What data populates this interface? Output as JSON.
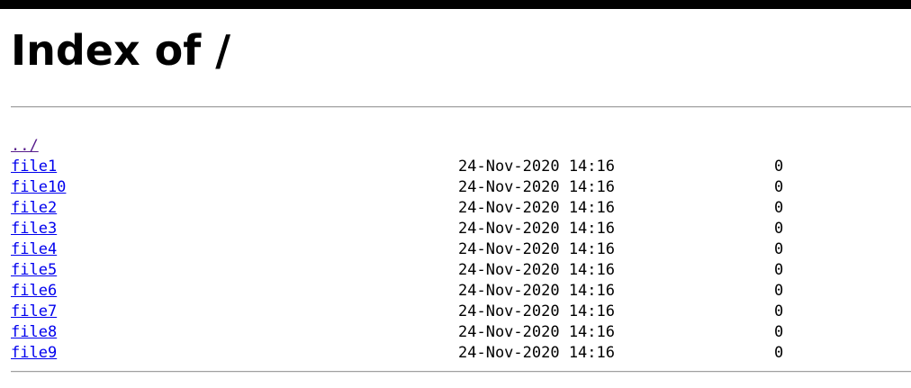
{
  "page_title": "Index of /",
  "listing": {
    "parent_link": "../",
    "entries": [
      {
        "name": "file1",
        "date": "24-Nov-2020 14:16",
        "size": "0"
      },
      {
        "name": "file10",
        "date": "24-Nov-2020 14:16",
        "size": "0"
      },
      {
        "name": "file2",
        "date": "24-Nov-2020 14:16",
        "size": "0"
      },
      {
        "name": "file3",
        "date": "24-Nov-2020 14:16",
        "size": "0"
      },
      {
        "name": "file4",
        "date": "24-Nov-2020 14:16",
        "size": "0"
      },
      {
        "name": "file5",
        "date": "24-Nov-2020 14:16",
        "size": "0"
      },
      {
        "name": "file6",
        "date": "24-Nov-2020 14:16",
        "size": "0"
      },
      {
        "name": "file7",
        "date": "24-Nov-2020 14:16",
        "size": "0"
      },
      {
        "name": "file8",
        "date": "24-Nov-2020 14:16",
        "size": "0"
      },
      {
        "name": "file9",
        "date": "24-Nov-2020 14:16",
        "size": "0"
      }
    ]
  },
  "colors": {
    "link": "#0000ee",
    "visited_link": "#551a8b",
    "top_bar": "#000000"
  }
}
